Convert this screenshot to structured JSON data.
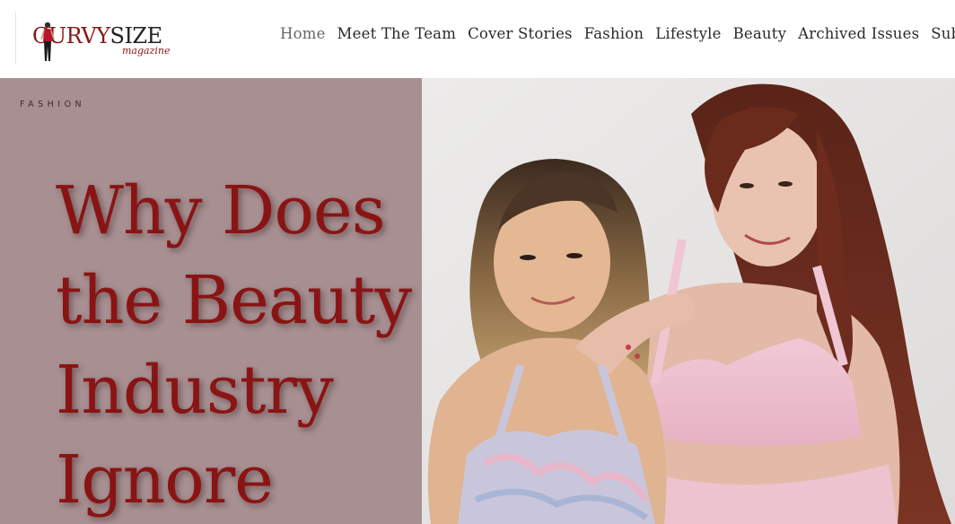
{
  "logo": {
    "letter_c": "C",
    "urvy": "URVY",
    "size": "SIZE",
    "sub": "magazine"
  },
  "nav": {
    "items": [
      {
        "label": "Home"
      },
      {
        "label": "Meet The Team"
      },
      {
        "label": "Cover Stories"
      },
      {
        "label": "Fashion"
      },
      {
        "label": "Lifestyle"
      },
      {
        "label": "Beauty"
      },
      {
        "label": "Archived Issues"
      },
      {
        "label": "Subm"
      }
    ]
  },
  "hero": {
    "category": "FASHION",
    "headline_lines": [
      "Why Does",
      "the Beauty",
      "Industry",
      "Ignore"
    ]
  },
  "colors": {
    "brand": "#8a1616",
    "panel": "#a89092",
    "headline": "#8a1414"
  }
}
